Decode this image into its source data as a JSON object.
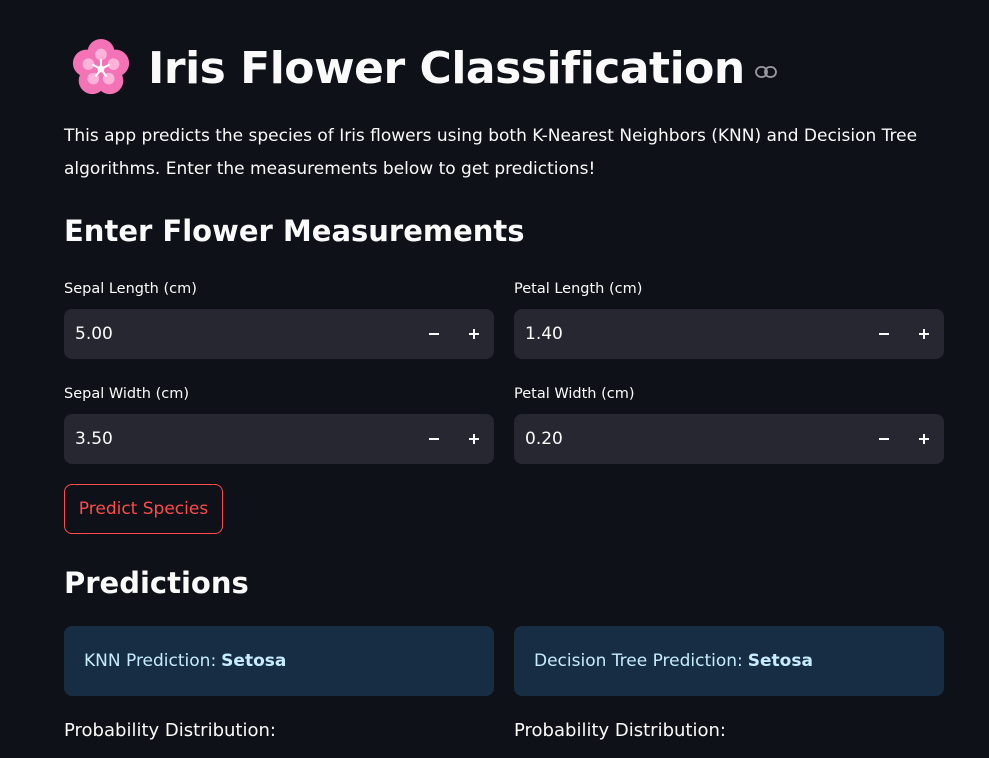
{
  "header": {
    "title": "Iris Flower Classification",
    "icon": "cherry-blossom-icon",
    "link_icon": "link-icon"
  },
  "description": "This app predicts the species of Iris flowers using both K-Nearest Neighbors (KNN) and Decision Tree algorithms. Enter the measurements below to get predictions!",
  "measurements": {
    "heading": "Enter Flower Measurements",
    "sepal_length": {
      "label": "Sepal Length (cm)",
      "value": "5.00"
    },
    "petal_length": {
      "label": "Petal Length (cm)",
      "value": "1.40"
    },
    "sepal_width": {
      "label": "Sepal Width (cm)",
      "value": "3.50"
    },
    "petal_width": {
      "label": "Petal Width (cm)",
      "value": "0.20"
    },
    "decrement_icon": "minus-icon",
    "increment_icon": "plus-icon"
  },
  "predict_button": "Predict Species",
  "predictions": {
    "heading": "Predictions",
    "knn": {
      "label": "KNN Prediction:",
      "value": "Setosa"
    },
    "tree": {
      "label": "Decision Tree Prediction:",
      "value": "Setosa"
    },
    "knn_prob_label": "Probability Distribution:",
    "tree_prob_label": "Probability Distribution:"
  },
  "colors": {
    "background": "#0e1117",
    "input_bg": "#262730",
    "accent": "#ff4b4b",
    "info_bg": "#172d43",
    "info_text": "#c7ebff",
    "flower_pink": "#f472b6"
  }
}
